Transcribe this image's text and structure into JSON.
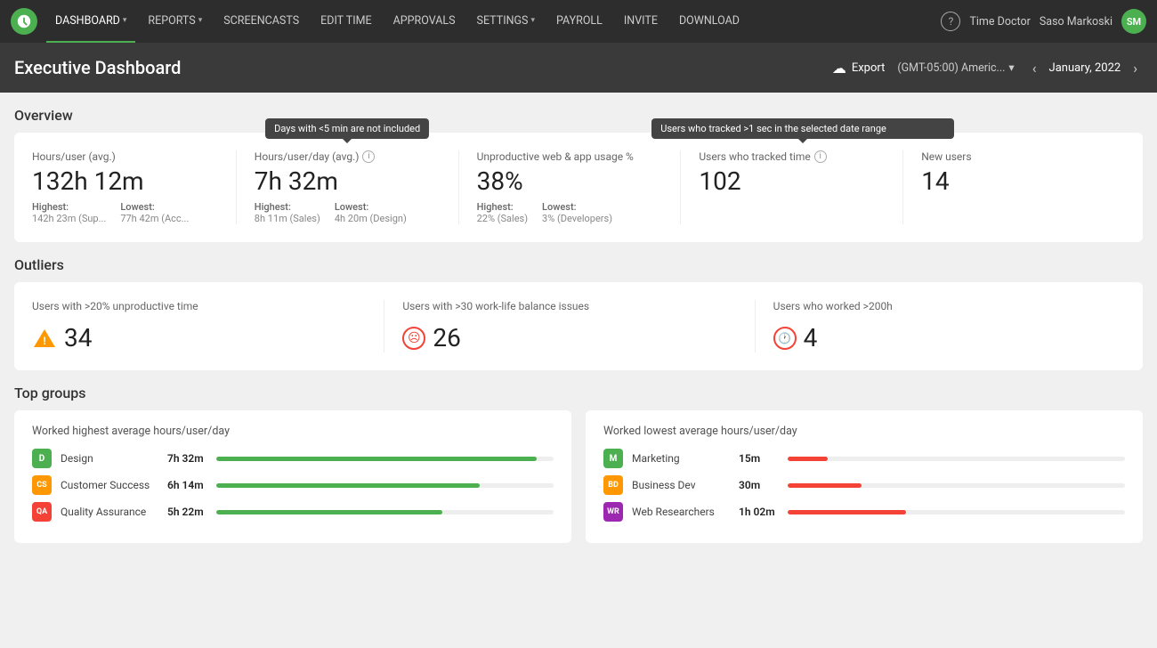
{
  "navbar": {
    "items": [
      {
        "label": "DASHBOARD",
        "active": true,
        "hasArrow": true
      },
      {
        "label": "REPORTS",
        "active": false,
        "hasArrow": true
      },
      {
        "label": "SCREENCASTS",
        "active": false,
        "hasArrow": false
      },
      {
        "label": "EDIT TIME",
        "active": false,
        "hasArrow": false
      },
      {
        "label": "APPROVALS",
        "active": false,
        "hasArrow": false
      },
      {
        "label": "SETTINGS",
        "active": false,
        "hasArrow": true
      },
      {
        "label": "PAYROLL",
        "active": false,
        "hasArrow": false
      },
      {
        "label": "INVITE",
        "active": false,
        "hasArrow": false
      },
      {
        "label": "DOWNLOAD",
        "active": false,
        "hasArrow": false
      }
    ],
    "company": "Time Doctor",
    "user": "Saso Markoski",
    "avatar_initials": "SM"
  },
  "page_header": {
    "title": "Executive Dashboard",
    "export_label": "Export",
    "timezone": "(GMT-05:00) Americ...",
    "date": "January, 2022"
  },
  "overview": {
    "section_title": "Overview",
    "tooltip1": {
      "text": "Days with <5 min are not included",
      "metric_index": 1
    },
    "tooltip2": {
      "text": "Users who tracked >1 sec in the selected date range",
      "metric_index": 3
    },
    "metrics": [
      {
        "label": "Hours/user (avg.)",
        "value": "132h 12m",
        "has_info": false,
        "highest_label": "Highest:",
        "highest_value": "142h 23m (Sup...",
        "lowest_label": "Lowest:",
        "lowest_value": "77h 42m (Acc..."
      },
      {
        "label": "Hours/user/day (avg.)",
        "value": "7h 32m",
        "has_info": true,
        "highest_label": "Highest:",
        "highest_value": "8h 11m (Sales)",
        "lowest_label": "Lowest:",
        "lowest_value": "4h 20m (Design)"
      },
      {
        "label": "Unproductive web & app usage %",
        "value": "38%",
        "has_info": false,
        "highest_label": "Highest:",
        "highest_value": "22% (Sales)",
        "lowest_label": "Lowest:",
        "lowest_value": "3% (Developers)"
      },
      {
        "label": "Users who tracked time",
        "value": "102",
        "has_info": true,
        "highest_label": "",
        "highest_value": "",
        "lowest_label": "",
        "lowest_value": ""
      },
      {
        "label": "New users",
        "value": "14",
        "has_info": false,
        "highest_label": "",
        "highest_value": "",
        "lowest_label": "",
        "lowest_value": ""
      }
    ]
  },
  "outliers": {
    "section_title": "Outliers",
    "items": [
      {
        "label": "Users with >20% unproductive time",
        "value": "34",
        "icon_type": "warning"
      },
      {
        "label": "Users with >30 work-life balance issues",
        "value": "26",
        "icon_type": "sad"
      },
      {
        "label": "Users who worked >200h",
        "value": "4",
        "icon_type": "clock"
      }
    ]
  },
  "top_groups": {
    "section_title": "Top groups",
    "highest_card": {
      "title": "Worked highest average hours/user/day",
      "groups": [
        {
          "badge": "D",
          "badge_color": "#4caf50",
          "name": "Design",
          "time": "7h 32m",
          "bar_pct": 95
        },
        {
          "badge": "CS",
          "badge_color": "#ff9800",
          "name": "Customer Success",
          "time": "6h 14m",
          "bar_pct": 78
        },
        {
          "badge": "QA",
          "badge_color": "#f44336",
          "name": "Quality Assurance",
          "time": "5h 22m",
          "bar_pct": 67
        }
      ]
    },
    "lowest_card": {
      "title": "Worked lowest average hours/user/day",
      "groups": [
        {
          "badge": "M",
          "badge_color": "#4caf50",
          "name": "Marketing",
          "time": "15m",
          "bar_pct": 12
        },
        {
          "badge": "BD",
          "badge_color": "#ff9800",
          "name": "Business Dev",
          "time": "30m",
          "bar_pct": 22
        },
        {
          "badge": "WR",
          "badge_color": "#9c27b0",
          "name": "Web Researchers",
          "time": "1h 02m",
          "bar_pct": 35
        }
      ]
    }
  }
}
